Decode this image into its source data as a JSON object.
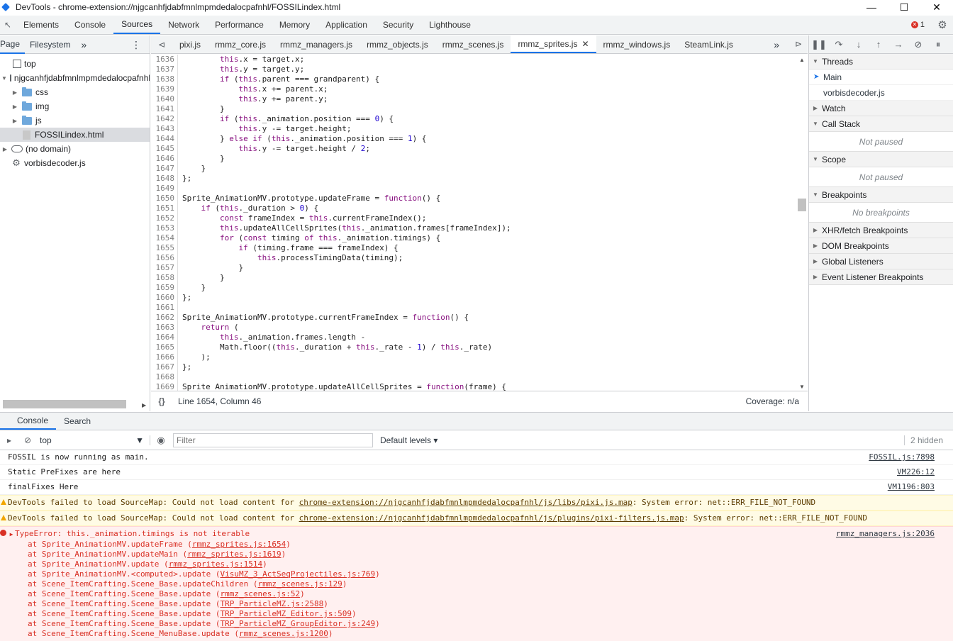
{
  "window": {
    "title": "DevTools - chrome-extension://njgcanhfjdabfmnlmpmdedalocpafnhl/FOSSILindex.html"
  },
  "main_tabs": [
    "Elements",
    "Console",
    "Sources",
    "Network",
    "Performance",
    "Memory",
    "Application",
    "Security",
    "Lighthouse"
  ],
  "active_main_tab": "Sources",
  "error_count": "1",
  "navigator": {
    "tabs": [
      "Page",
      "Filesystem"
    ],
    "tree": [
      {
        "label": "top",
        "indent": 0,
        "type": "box",
        "tri": ""
      },
      {
        "label": "njgcanhfjdabfmnlmpmdedalocpafnhl",
        "indent": 0,
        "type": "cloud",
        "tri": "▼"
      },
      {
        "label": "css",
        "indent": 1,
        "type": "folder",
        "tri": "▶"
      },
      {
        "label": "img",
        "indent": 1,
        "type": "folder",
        "tri": "▶"
      },
      {
        "label": "js",
        "indent": 1,
        "type": "folder",
        "tri": "▶"
      },
      {
        "label": "FOSSILindex.html",
        "indent": 1,
        "type": "file",
        "tri": "",
        "selected": true
      },
      {
        "label": "(no domain)",
        "indent": 0,
        "type": "cloud",
        "tri": "▶"
      },
      {
        "label": "vorbisdecoder.js",
        "indent": 0,
        "type": "cog",
        "tri": ""
      }
    ]
  },
  "editor": {
    "tabs": [
      "pixi.js",
      "rmmz_core.js",
      "rmmz_managers.js",
      "rmmz_objects.js",
      "rmmz_scenes.js",
      "rmmz_sprites.js",
      "rmmz_windows.js",
      "SteamLink.js"
    ],
    "active_tab": "rmmz_sprites.js",
    "status_position": "Line 1654, Column 46",
    "coverage": "Coverage: n/a",
    "lines": [
      {
        "n": "1636",
        "t": "        this.x = target.x;"
      },
      {
        "n": "1637",
        "t": "        this.y = target.y;"
      },
      {
        "n": "1638",
        "t": "        if (this.parent === grandparent) {"
      },
      {
        "n": "1639",
        "t": "            this.x += parent.x;"
      },
      {
        "n": "1640",
        "t": "            this.y += parent.y;"
      },
      {
        "n": "1641",
        "t": "        }"
      },
      {
        "n": "1642",
        "t": "        if (this._animation.position === 0) {"
      },
      {
        "n": "1643",
        "t": "            this.y -= target.height;"
      },
      {
        "n": "1644",
        "t": "        } else if (this._animation.position === 1) {"
      },
      {
        "n": "1645",
        "t": "            this.y -= target.height / 2;"
      },
      {
        "n": "1646",
        "t": "        }"
      },
      {
        "n": "1647",
        "t": "    }"
      },
      {
        "n": "1648",
        "t": "};"
      },
      {
        "n": "1649",
        "t": ""
      },
      {
        "n": "1650",
        "t": "Sprite_AnimationMV.prototype.updateFrame = function() {"
      },
      {
        "n": "1651",
        "t": "    if (this._duration > 0) {"
      },
      {
        "n": "1652",
        "t": "        const frameIndex = this.currentFrameIndex();"
      },
      {
        "n": "1653",
        "t": "        this.updateAllCellSprites(this._animation.frames[frameIndex]);"
      },
      {
        "n": "1654",
        "t": "        for (const timing of this._animation.timings) {"
      },
      {
        "n": "1655",
        "t": "            if (timing.frame === frameIndex) {"
      },
      {
        "n": "1656",
        "t": "                this.processTimingData(timing);"
      },
      {
        "n": "1657",
        "t": "            }"
      },
      {
        "n": "1658",
        "t": "        }"
      },
      {
        "n": "1659",
        "t": "    }"
      },
      {
        "n": "1660",
        "t": "};"
      },
      {
        "n": "1661",
        "t": ""
      },
      {
        "n": "1662",
        "t": "Sprite_AnimationMV.prototype.currentFrameIndex = function() {"
      },
      {
        "n": "1663",
        "t": "    return ("
      },
      {
        "n": "1664",
        "t": "        this._animation.frames.length -"
      },
      {
        "n": "1665",
        "t": "        Math.floor((this._duration + this._rate - 1) / this._rate)"
      },
      {
        "n": "1666",
        "t": "    );"
      },
      {
        "n": "1667",
        "t": "};"
      },
      {
        "n": "1668",
        "t": ""
      },
      {
        "n": "1669",
        "t": "Sprite_AnimationMV.prototype.updateAllCellSprites = function(frame) {"
      }
    ]
  },
  "debugger": {
    "threads_label": "Threads",
    "threads": [
      "Main",
      "vorbisdecoder.js"
    ],
    "watch_label": "Watch",
    "callstack_label": "Call Stack",
    "callstack_empty": "Not paused",
    "scope_label": "Scope",
    "scope_empty": "Not paused",
    "breakpoints_label": "Breakpoints",
    "breakpoints_empty": "No breakpoints",
    "sections": [
      "XHR/fetch Breakpoints",
      "DOM Breakpoints",
      "Global Listeners",
      "Event Listener Breakpoints"
    ]
  },
  "drawer": {
    "tabs": [
      "Console",
      "Search"
    ],
    "context": "top",
    "filter_placeholder": "Filter",
    "levels": "Default levels",
    "hidden": "2 hidden",
    "messages": [
      {
        "text": "FOSSIL is now running as main.",
        "src": "FOSSIL.js:7898"
      },
      {
        "text": "Static PreFixes are here",
        "src": "VM226:12"
      },
      {
        "text": "finalFixes Here",
        "src": "VM1196:803"
      }
    ],
    "warnings": [
      {
        "prefix": "DevTools failed to load SourceMap: Could not load content for ",
        "link": "chrome-extension://njgcanhfjdabfmnlmpmdedalocpafnhl/js/libs/pixi.js.map",
        "suffix": ": System error: net::ERR_FILE_NOT_FOUND"
      },
      {
        "prefix": "DevTools failed to load SourceMap: Could not load content for ",
        "link": "chrome-extension://njgcanhfjdabfmnlmpmdedalocpafnhl/js/plugins/pixi-filters.js.map",
        "suffix": ": System error: net::ERR_FILE_NOT_FOUND"
      }
    ],
    "error": {
      "title": "TypeError: this._animation.timings is not iterable",
      "src": "rmmz_managers.js:2036",
      "stack": [
        {
          "at": "at Sprite_AnimationMV.updateFrame (",
          "link": "rmmz_sprites.js:1654"
        },
        {
          "at": "at Sprite_AnimationMV.updateMain (",
          "link": "rmmz_sprites.js:1619"
        },
        {
          "at": "at Sprite_AnimationMV.update (",
          "link": "rmmz_sprites.js:1514"
        },
        {
          "at": "at Sprite_AnimationMV.<computed>.update (",
          "link": "VisuMZ_3_ActSeqProjectiles.js:769"
        },
        {
          "at": "at Scene_ItemCrafting.Scene_Base.updateChildren (",
          "link": "rmmz_scenes.js:129"
        },
        {
          "at": "at Scene_ItemCrafting.Scene_Base.update (",
          "link": "rmmz_scenes.js:52"
        },
        {
          "at": "at Scene_ItemCrafting.Scene_Base.update (",
          "link": "TRP_ParticleMZ.js:2588"
        },
        {
          "at": "at Scene_ItemCrafting.Scene_Base.update (",
          "link": "TRP_ParticleMZ_Editor.js:509"
        },
        {
          "at": "at Scene_ItemCrafting.Scene_Base.update (",
          "link": "TRP_ParticleMZ_GroupEditor.js:249"
        },
        {
          "at": "at Scene_ItemCrafting.Scene_MenuBase.update (",
          "link": "rmmz_scenes.js:1200"
        }
      ]
    }
  }
}
